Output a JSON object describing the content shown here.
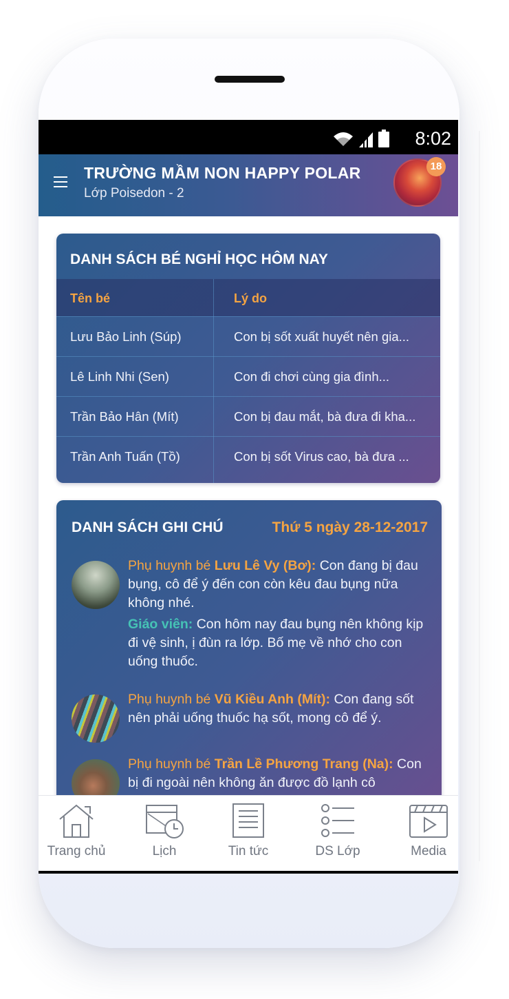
{
  "status_bar": {
    "time": "8:02"
  },
  "header": {
    "school_name": "TRƯỜNG MẦM NON HAPPY POLAR",
    "class_name": "Lớp Poisedon - 2",
    "notification_count": "18"
  },
  "absence": {
    "title": "DANH SÁCH BÉ NGHỈ HỌC HÔM NAY",
    "columns": [
      "Tên bé",
      "Lý do"
    ],
    "rows": [
      {
        "name": "Lưu Bảo Linh (Súp)",
        "reason": "Con bị sốt xuất huyết nên gia..."
      },
      {
        "name": "Lê Linh Nhi (Sen)",
        "reason": "Con đi chơi cùng gia đình..."
      },
      {
        "name": "Trần Bảo Hân (Mít)",
        "reason": "Con bị đau mắt, bà đưa đi kha..."
      },
      {
        "name": "Trần Anh Tuấn (Tồ)",
        "reason": "Con bị sốt Virus cao, bà đưa ..."
      }
    ]
  },
  "notes": {
    "title": "DANH SÁCH GHI CHÚ",
    "date": "Thứ 5 ngày 28-12-2017",
    "items": [
      {
        "parent_label": "Phụ huynh bé",
        "child": "Lưu Lê Vy (Bơ):",
        "text": "Con đang bị đau bụng, cô để ý đến con còn kêu đau bụng nữa không nhé.",
        "teacher_label": "Giáo viên:",
        "teacher_text": "Con hôm nay đau bụng nên không kịp đi vệ sinh, ị đùn ra lớp. Bố mẹ về nhớ cho con uống thuốc."
      },
      {
        "parent_label": "Phụ huynh bé",
        "child": "Vũ Kiều Anh (Mít):",
        "text": "Con đang sốt nên phải uống thuốc hạ sốt, mong cô để ý."
      },
      {
        "parent_label": "Phụ huynh bé",
        "child": "Trần Lề Phương Trang (Na):",
        "text": "Con bị đi ngoài nên không ăn được đồ lạnh cô"
      }
    ]
  },
  "nav": {
    "items": [
      {
        "label": "Trang chủ",
        "icon": "home-icon"
      },
      {
        "label": "Lịch",
        "icon": "calendar-icon"
      },
      {
        "label": "Tin tức",
        "icon": "news-icon"
      },
      {
        "label": "DS Lớp",
        "icon": "class-list-icon"
      },
      {
        "label": "Media",
        "icon": "media-icon"
      }
    ]
  },
  "colors": {
    "accent_orange": "#f5a442",
    "teacher_teal": "#46c2b5",
    "header_start": "#245d8c",
    "header_end": "#6d4f94"
  }
}
